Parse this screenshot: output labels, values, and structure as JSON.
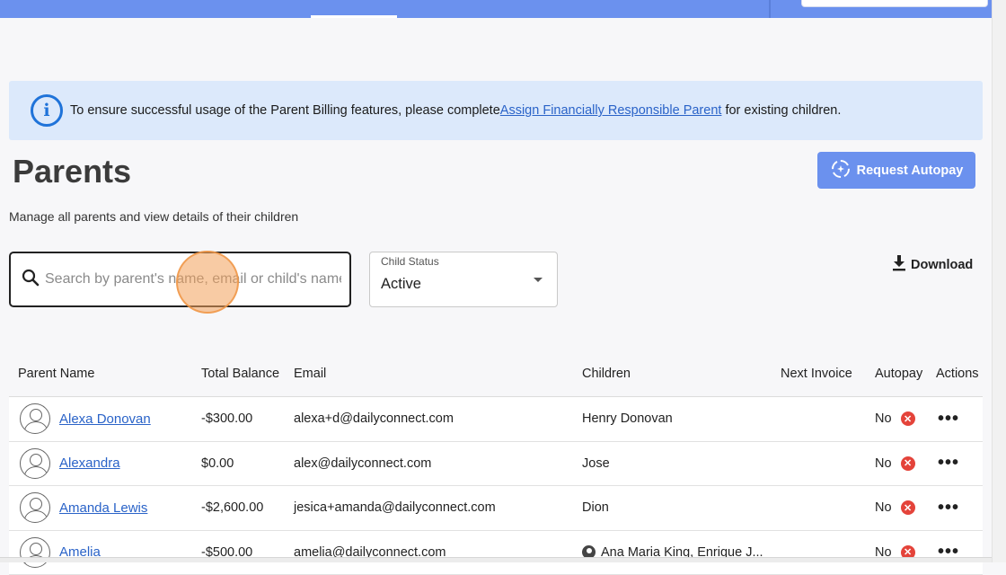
{
  "banner": {
    "text_before": "To ensure successful usage of the Parent Billing features, please complete",
    "link_text": "Assign Financially Responsible Parent",
    "text_after": " for existing children."
  },
  "page": {
    "title": "Parents",
    "subtitle": "Manage all parents and view details of their children"
  },
  "actions": {
    "request_autopay": "Request Autopay",
    "download": "Download"
  },
  "search": {
    "placeholder": "Search by parent's name, email or child's name",
    "value": ""
  },
  "filter": {
    "label": "Child Status",
    "value": "Active"
  },
  "table": {
    "headers": {
      "parent_name": "Parent Name",
      "total_balance": "Total Balance",
      "email": "Email",
      "children": "Children",
      "next_invoice": "Next Invoice",
      "autopay": "Autopay",
      "actions": "Actions"
    },
    "rows": [
      {
        "name": "Alexa Donovan",
        "balance": "-$300.00",
        "email": "alexa+d@dailyconnect.com",
        "children": "Henry Donovan",
        "next_invoice": "",
        "autopay": "No"
      },
      {
        "name": "Alexandra",
        "balance": "$0.00",
        "email": "alex@dailyconnect.com",
        "children": "Jose",
        "next_invoice": "",
        "autopay": "No"
      },
      {
        "name": "Amanda Lewis",
        "balance": "-$2,600.00",
        "email": "jesica+amanda@dailyconnect.com",
        "children": "Dion",
        "next_invoice": "",
        "autopay": "No"
      },
      {
        "name": "Amelia",
        "balance": "-$500.00",
        "email": "amelia@dailyconnect.com",
        "children": "Ana Maria King, Enrique J...",
        "next_invoice": "",
        "autopay": "No"
      }
    ]
  },
  "icons": {
    "info": "info-icon",
    "autopay": "autopay-sync-icon",
    "download": "download-icon",
    "search": "search-icon",
    "avatar": "user-avatar-icon",
    "autopay_off": "x-circle-icon",
    "more": "more-horizontal-icon"
  },
  "colors": {
    "primary": "#6b91ee",
    "link": "#2a63c8",
    "banner_bg": "#dce9fb",
    "danger": "#e4433a"
  }
}
